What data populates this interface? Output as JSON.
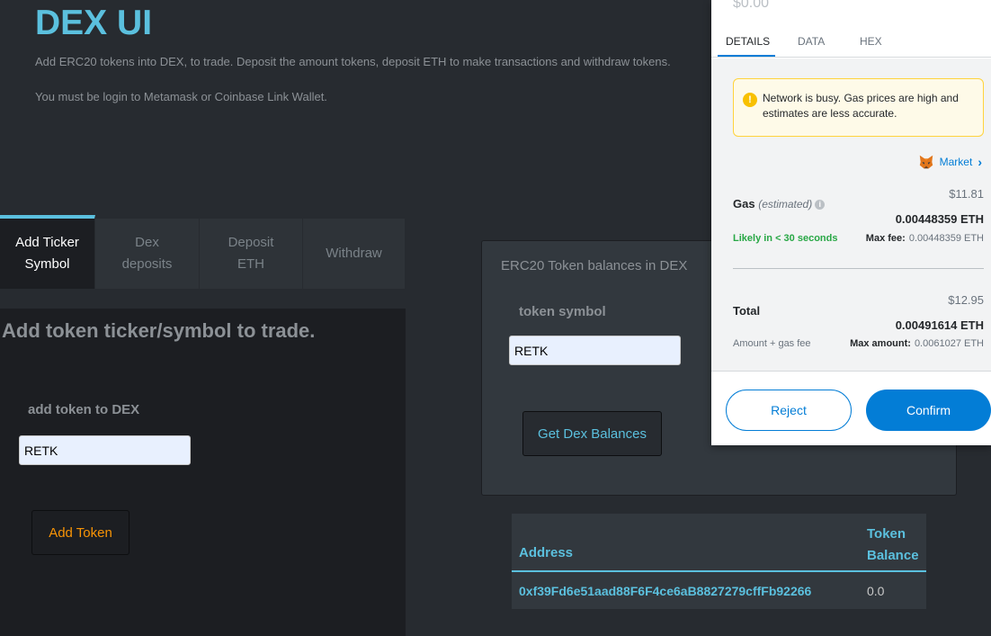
{
  "header": {
    "title": "DEX UI",
    "description": "Add ERC20 tokens into DEX, to trade. Deposit the amount tokens, deposit ETH to make transactions and withdraw tokens.",
    "login_note": "You must be login to Metamask or Coinbase Link Wallet."
  },
  "tabs": [
    {
      "label_line1": "Add Ticker",
      "label_line2": "Symbol"
    },
    {
      "label_line1": "Dex",
      "label_line2": "deposits"
    },
    {
      "label_line1": "Deposit",
      "label_line2": "ETH"
    },
    {
      "label": "Withdraw"
    }
  ],
  "add_token": {
    "heading": "Add token ticker/symbol to trade.",
    "label": "add token to DEX",
    "input_value": "RETK",
    "button": "Add Token"
  },
  "balances_panel": {
    "title": "ERC20 Token balances in DEX",
    "label": "token symbol",
    "input_value": "RETK",
    "button": "Get Dex Balances"
  },
  "balances_table": {
    "col_address": "Address",
    "col_token_line1": "Token",
    "col_token_line2": "Balance",
    "rows": [
      {
        "address": "0xf39Fd6e51aad88F6F4ce6aB8827279cffFb92266",
        "balance": "0.0"
      }
    ]
  },
  "metamask": {
    "fiat_top": "$0.00",
    "tabs": {
      "details": "DETAILS",
      "data": "DATA",
      "hex": "HEX"
    },
    "warning": "Network is busy. Gas prices are high and estimates are less accurate.",
    "market": "Market",
    "gas_label": "Gas",
    "gas_estimated": "(estimated)",
    "gas_usd": "$11.81",
    "gas_eth": "0.00448359 ETH",
    "likely": "Likely in < 30 seconds",
    "max_fee_label": "Max fee:",
    "max_fee_value": "0.00448359 ETH",
    "total_label": "Total",
    "total_usd": "$12.95",
    "total_eth": "0.00491614 ETH",
    "amount_gas_fee": "Amount + gas fee",
    "max_amount_label": "Max amount:",
    "max_amount_value": "0.0061027 ETH",
    "reject": "Reject",
    "confirm": "Confirm"
  },
  "colors": {
    "accent": "#5bc0de",
    "warning": "#f89406",
    "metamask_blue": "#037dd6",
    "success": "#28a745"
  }
}
